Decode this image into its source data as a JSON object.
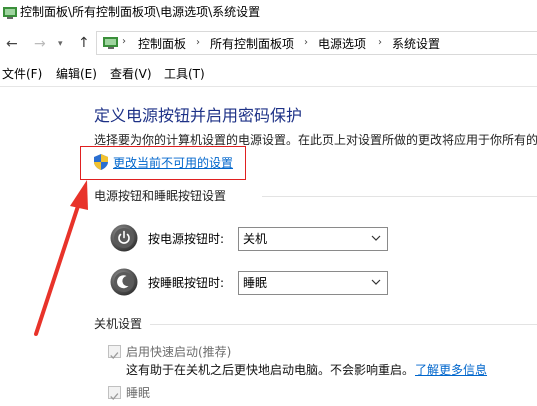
{
  "window": {
    "title": "控制面板\\所有控制面板项\\电源选项\\系统设置"
  },
  "address": {
    "crumbs": [
      "控制面板",
      "所有控制面板项",
      "电源选项",
      "系统设置"
    ]
  },
  "menu": {
    "items": [
      "文件(F)",
      "编辑(E)",
      "查看(V)",
      "工具(T)"
    ]
  },
  "content": {
    "title": "定义电源按钮并启用密码保护",
    "description": "选择要为你的计算机设置的电源设置。在此页上对设置所做的更改将应用于你所有的",
    "change_link": "更改当前不可用的设置",
    "power_section": {
      "title": "电源按钮和睡眠按钮设置",
      "power_button_label": "按电源按钮时:",
      "power_button_value": "关机",
      "sleep_button_label": "按睡眠按钮时:",
      "sleep_button_value": "睡眠"
    },
    "shutdown_section": {
      "title": "关机设置",
      "fast_startup_label": "启用快速启动(推荐)",
      "fast_startup_checked": true,
      "fast_startup_note": "这有助于在关机之后更快地启动电脑。不会影响重启。",
      "learn_more": "了解更多信息",
      "sleep_label": "睡眠",
      "sleep_checked": true
    }
  },
  "colors": {
    "title_blue": "#1e3287",
    "link_blue": "#0066cc",
    "annotation_red": "#e02020"
  }
}
